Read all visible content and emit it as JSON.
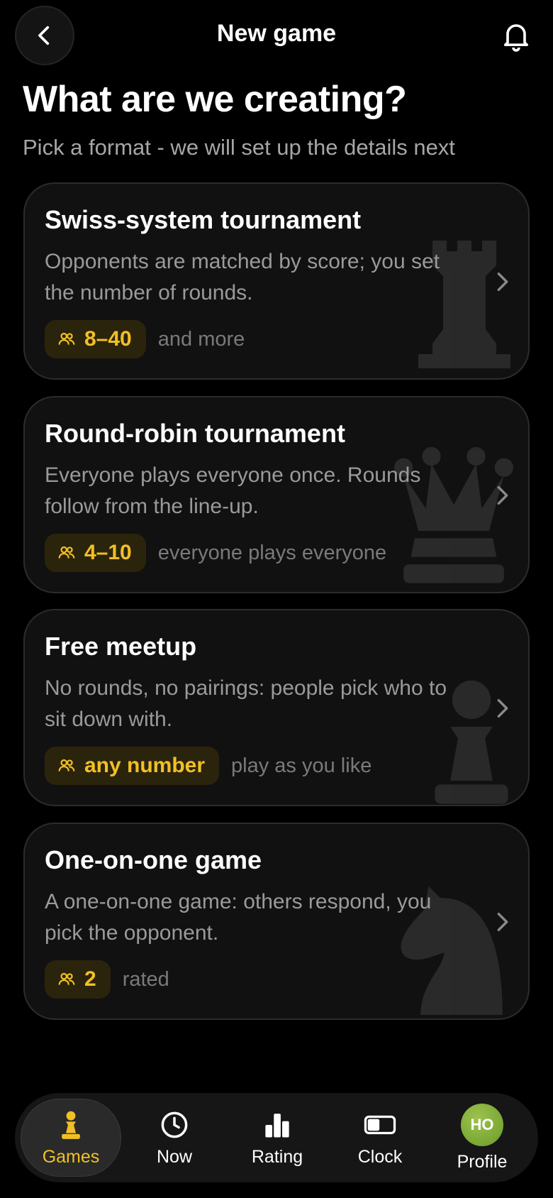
{
  "header": {
    "title": "New game"
  },
  "intro": {
    "heading": "What are we creating?",
    "subheading": "Pick a format - we will set up the details next"
  },
  "cards": [
    {
      "title": "Swiss-system tournament",
      "description": "Opponents are matched by score; you set the number of rounds.",
      "players": "8–40",
      "note": "and more",
      "watermark": "rook-icon"
    },
    {
      "title": "Round-robin tournament",
      "description": "Everyone plays everyone once. Rounds follow from the line-up.",
      "players": "4–10",
      "note": "everyone plays everyone",
      "watermark": "queen-icon"
    },
    {
      "title": "Free meetup",
      "description": "No rounds, no pairings: people pick who to sit down with.",
      "players": "any number",
      "note": "play as you like",
      "watermark": "pawn-icon"
    },
    {
      "title": "One-on-one game",
      "description": "A one-on-one game: others respond, you pick the opponent.",
      "players": "2",
      "note": "rated",
      "watermark": "knight-icon"
    }
  ],
  "nav": {
    "items": [
      {
        "label": "Games",
        "icon": "pawn-icon",
        "active": true
      },
      {
        "label": "Now",
        "icon": "clock-icon"
      },
      {
        "label": "Rating",
        "icon": "bar-chart-icon"
      },
      {
        "label": "Clock",
        "icon": "chess-clock-icon"
      },
      {
        "label": "Profile",
        "icon": "avatar",
        "initials": "HO"
      }
    ]
  },
  "colors": {
    "background": "#000000",
    "card": "#111111",
    "accent": "#f2c025",
    "badge_bg": "#2b240c",
    "avatar": "#86b43a"
  }
}
